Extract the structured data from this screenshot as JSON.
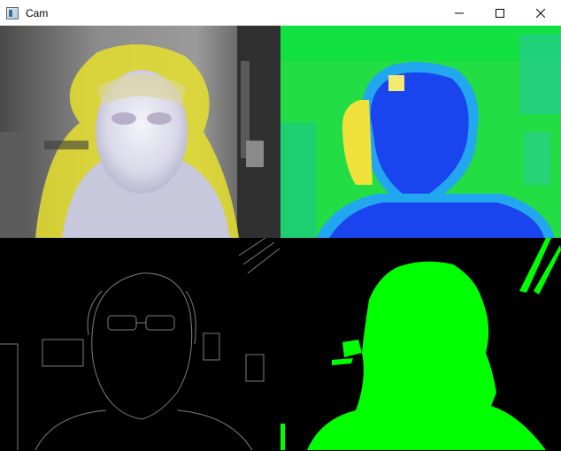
{
  "window": {
    "title": "Cam",
    "icons": {
      "app": "app-window-icon",
      "minimize": "minimize-icon",
      "maximize": "maximize-icon",
      "close": "close-icon"
    }
  },
  "views": [
    {
      "name": "inverted-color-view",
      "colors": {
        "bg": "#707070",
        "face": "#e8e8f4",
        "hair": "#e8e030"
      }
    },
    {
      "name": "colormap-view",
      "colors": {
        "bg": "#22dd44",
        "person": "#1a44ee",
        "halo": "#22a6f0",
        "light": "#f0e23a"
      }
    },
    {
      "name": "edge-detection-view",
      "colors": {
        "bg": "#000000",
        "edge": "#9a9a9a"
      }
    },
    {
      "name": "green-mask-view",
      "colors": {
        "bg": "#000000",
        "mask": "#00ff00"
      }
    }
  ]
}
